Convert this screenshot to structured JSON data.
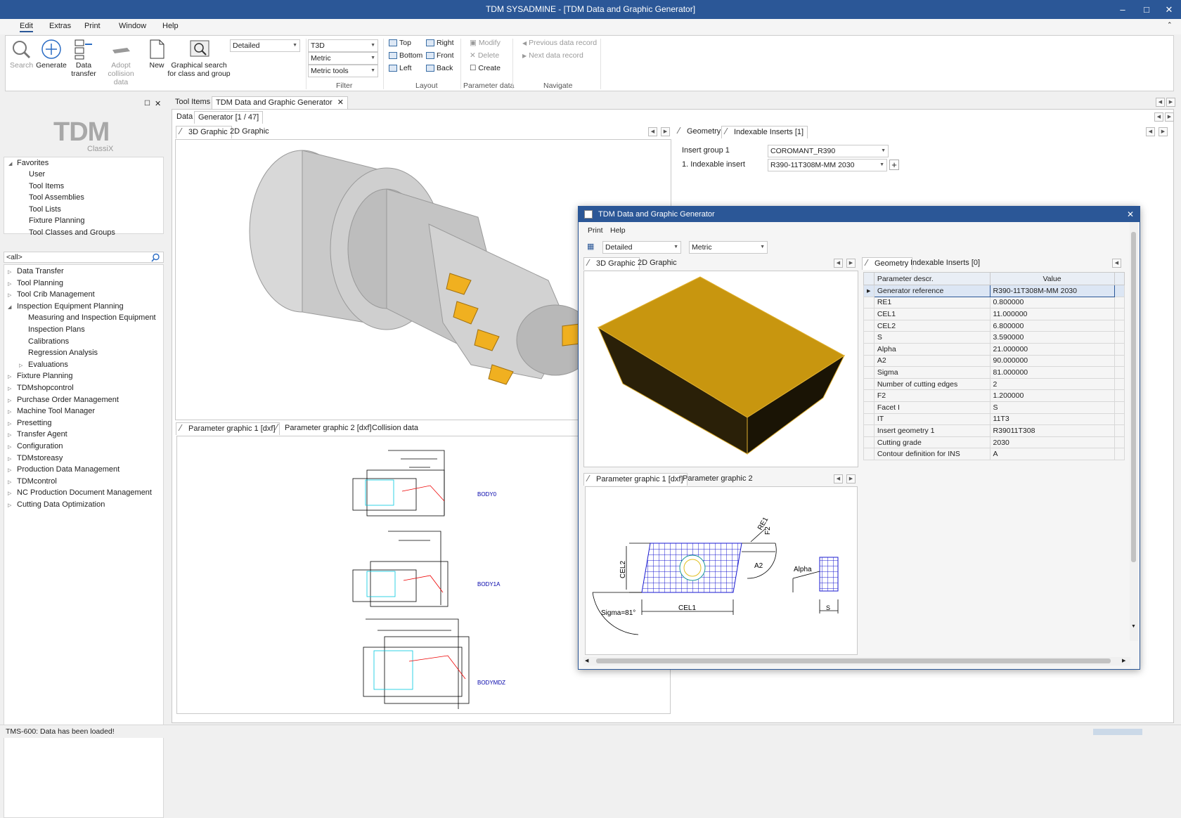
{
  "window": {
    "title": "TDM SYSADMINE - [TDM Data and Graphic Generator]"
  },
  "menu": {
    "edit": "Edit",
    "extras": "Extras",
    "print": "Print",
    "window": "Window",
    "help": "Help"
  },
  "ribbon": {
    "search": "Search",
    "generate": "Generate",
    "data_transfer": "Data transfer",
    "adopt": "Adopt collision data",
    "new": "New",
    "graphical": "Graphical search for class and group",
    "combo_detail": "Detailed",
    "combo_t3d": "T3D",
    "combo_metric": "Metric",
    "combo_tools": "Metric tools",
    "group_filter": "Filter",
    "layout": {
      "top": "Top",
      "right": "Right",
      "bottom": "Bottom",
      "front": "Front",
      "left": "Left",
      "back": "Back",
      "group": "Layout"
    },
    "param": {
      "modify": "Modify",
      "delete": "Delete",
      "create": "Create",
      "group": "Parameter data"
    },
    "navigate": {
      "prev": "Previous data record",
      "next": "Next data record",
      "group": "Navigate"
    }
  },
  "sidebar": {
    "logo": "TDM",
    "logo_sub": "ClassiX",
    "favorites": "Favorites",
    "fav_items": [
      "User",
      "Tool Items",
      "Tool Assemblies",
      "Tool Lists",
      "Fixture Planning",
      "Tool Classes and Groups"
    ],
    "filter": "<all>",
    "modules": [
      {
        "label": "Data Transfer",
        "level": 0
      },
      {
        "label": "Tool Planning",
        "level": 0
      },
      {
        "label": "Tool Crib Management",
        "level": 0
      },
      {
        "label": "Inspection Equipment Planning",
        "level": 0,
        "open": true
      },
      {
        "label": "Measuring and Inspection Equipment",
        "level": 1
      },
      {
        "label": "Inspection Plans",
        "level": 1
      },
      {
        "label": "Calibrations",
        "level": 1
      },
      {
        "label": "Regression Analysis",
        "level": 1
      },
      {
        "label": "Evaluations",
        "level": 1,
        "exp": true
      },
      {
        "label": "Fixture Planning",
        "level": 0
      },
      {
        "label": "TDMshopcontrol",
        "level": 0
      },
      {
        "label": "Purchase Order Management",
        "level": 0
      },
      {
        "label": "Machine Tool Manager",
        "level": 0
      },
      {
        "label": "Presetting",
        "level": 0
      },
      {
        "label": "Transfer Agent",
        "level": 0
      },
      {
        "label": "Configuration",
        "level": 0
      },
      {
        "label": "TDMstoreasy",
        "level": 0
      },
      {
        "label": "Production Data Management",
        "level": 0
      },
      {
        "label": "TDMcontrol",
        "level": 0
      },
      {
        "label": "NC Production Document Management",
        "level": 0
      },
      {
        "label": "Cutting Data Optimization",
        "level": 0
      }
    ]
  },
  "doc_tabs": {
    "tool_items": "Tool Items",
    "generator": "TDM Data and Graphic Generator"
  },
  "sub_tabs": {
    "data": "Data",
    "generator": "Generator [1 / 47]"
  },
  "graphic_tabs": {
    "g3d": "3D Graphic",
    "g2d": "2D Graphic"
  },
  "param_tabs": {
    "p1": "Parameter graphic 1 [dxf]",
    "p2": "Parameter graphic 2 [dxf]",
    "collision": "Collision data"
  },
  "drawing_labels": {
    "body0": "BODY0",
    "body1a": "BODY1A",
    "bodymdz": "BODYMDZ"
  },
  "right_tabs": {
    "geometry": "Geometry",
    "inserts": "Indexable Inserts [1]"
  },
  "inserts_form": {
    "group_label": "Insert group 1",
    "group_value": "COROMANT_R390",
    "insert_label": "1. Indexable insert",
    "insert_value": "R390-11T308M-MM 2030"
  },
  "dialog": {
    "title": "TDM Data and Graphic Generator",
    "menu_print": "Print",
    "menu_help": "Help",
    "combo_detail": "Detailed",
    "combo_metric": "Metric",
    "tab_3d": "3D Graphic",
    "tab_2d": "2D Graphic",
    "tab_geometry": "Geometry",
    "tab_inserts": "Indexable Inserts [0]",
    "tab_p1": "Parameter graphic 1 [dxf]",
    "tab_p2": "Parameter graphic 2",
    "col_param": "Parameter descr.",
    "col_value": "Value",
    "rows": [
      [
        "Generator reference",
        "R390-11T308M-MM 2030"
      ],
      [
        "RE1",
        "0.800000"
      ],
      [
        "CEL1",
        "11.000000"
      ],
      [
        "CEL2",
        "6.800000"
      ],
      [
        "S",
        "3.590000"
      ],
      [
        "Alpha",
        "21.000000"
      ],
      [
        "A2",
        "90.000000"
      ],
      [
        "Sigma",
        "81.000000"
      ],
      [
        "Number of cutting edges",
        "2"
      ],
      [
        "F2",
        "1.200000"
      ],
      [
        "Facet I",
        "S"
      ],
      [
        "IT",
        "11T3"
      ],
      [
        "Insert geometry 1",
        "R39011T308"
      ],
      [
        "Cutting grade",
        "2030"
      ],
      [
        "Contour definition for INS",
        "A"
      ]
    ],
    "dims": {
      "re1": "RE1",
      "f2": "F2",
      "cel2": "CEL2",
      "a2": "A2",
      "alpha": "Alpha",
      "sigma": "Sigma=81°",
      "cel1": "CEL1",
      "s": "S"
    }
  },
  "status": "TMS-600: Data has been loaded!",
  "colors": {
    "titlebar": "#2b5797",
    "insert": "#d4a013"
  }
}
